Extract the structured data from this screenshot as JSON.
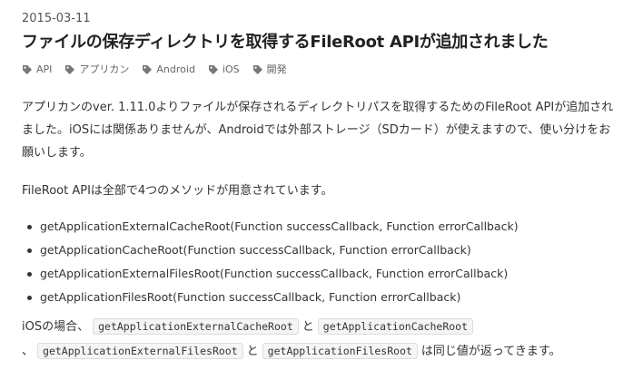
{
  "date": "2015-03-11",
  "title": "ファイルの保存ディレクトリを取得するFileRoot APIが追加されました",
  "tags": [
    {
      "label": "API",
      "icon": "tag-icon"
    },
    {
      "label": "アプリカン",
      "icon": "tag-icon"
    },
    {
      "label": "Android",
      "icon": "tag-icon"
    },
    {
      "label": "iOS",
      "icon": "tag-icon"
    },
    {
      "label": "開発",
      "icon": "tag-icon"
    }
  ],
  "paragraph1": "アプリカンのver. 1.11.0よりファイルが保存されるディレクトリパスを取得するためのFileRoot APIが追加されました。iOSには関係ありませんが、Androidでは外部ストレージ（SDカード）が使えますので、使い分けをお願いします。",
  "paragraph2": "FileRoot APIは全部で4つのメソッドが用意されています。",
  "methods": [
    "getApplicationExternalCacheRoot(Function successCallback, Function errorCallback)",
    "getApplicationCacheRoot(Function successCallback, Function errorCallback)",
    "getApplicationExternalFilesRoot(Function successCallback, Function errorCallback)",
    "getApplicationFilesRoot(Function successCallback, Function errorCallback)"
  ],
  "paragraph3": {
    "prefix": "iOSの場合、",
    "code1": "getApplicationExternalCacheRoot",
    "and1": "と",
    "code2": "getApplicationCacheRoot",
    "sep": "、",
    "code3": "getApplicationExternalFilesRoot",
    "and2": "と",
    "code4": "getApplicationFilesRoot",
    "suffix": "は同じ値が返ってきます。"
  }
}
